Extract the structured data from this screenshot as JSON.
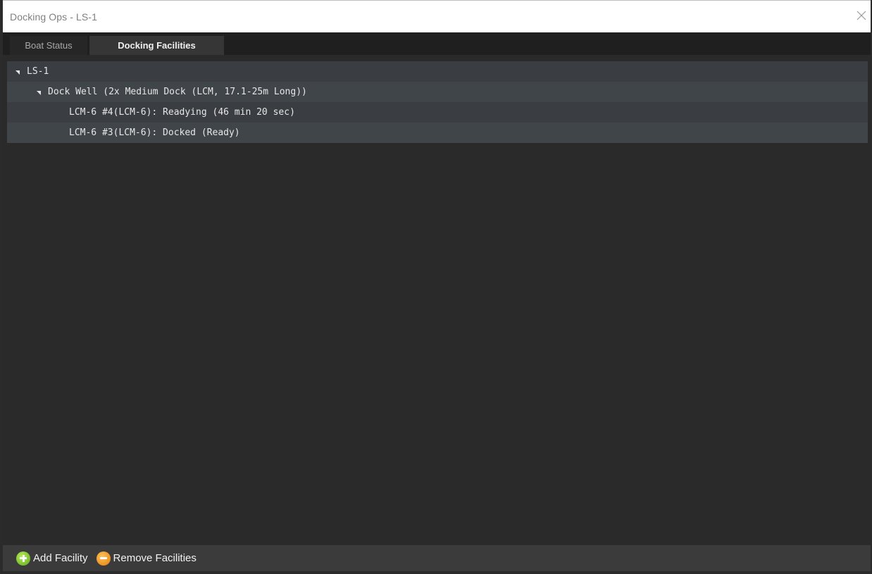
{
  "window": {
    "title": "Docking Ops - LS-1"
  },
  "tabs": [
    {
      "label": "Boat Status",
      "active": false
    },
    {
      "label": "Docking Facilities",
      "active": true
    }
  ],
  "tree": {
    "root": {
      "label": "LS-1",
      "expanded": true,
      "children": [
        {
          "label": "Dock Well (2x Medium Dock (LCM, 17.1-25m Long))",
          "expanded": true,
          "children": [
            {
              "label": "LCM-6 #4(LCM-6): Readying (46 min 20 sec)"
            },
            {
              "label": "LCM-6 #3(LCM-6): Docked (Ready)"
            }
          ]
        }
      ]
    }
  },
  "footer": {
    "add_label": "Add Facility",
    "remove_label": "Remove Facilities"
  },
  "colors": {
    "add": "#6cc21f",
    "remove": "#f39a1e",
    "panel": "#2a2a2a",
    "tree_bg": "#3a3e42"
  }
}
